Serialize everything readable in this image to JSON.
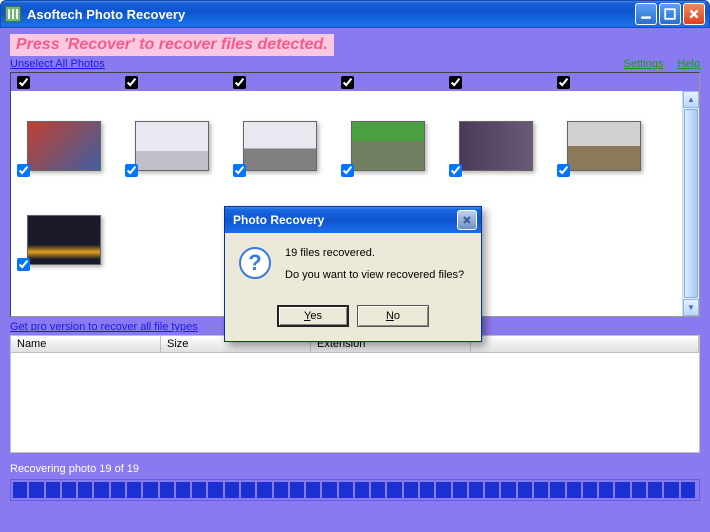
{
  "window": {
    "title": "Asoftech Photo Recovery"
  },
  "instruction": "Press 'Recover' to recover files detected.",
  "links": {
    "unselect": "Unselect All Photos",
    "settings": "Settings",
    "help": "Help",
    "pro": "Get pro version to recover all file types"
  },
  "table": {
    "headers": [
      "Name",
      "Size",
      "Extension"
    ]
  },
  "status": "Recovering photo 19 of 19",
  "dialog": {
    "title": "Photo Recovery",
    "line1": "19 files recovered.",
    "line2": "Do you want to view recovered files?",
    "yes": "Yes",
    "no": "No"
  }
}
